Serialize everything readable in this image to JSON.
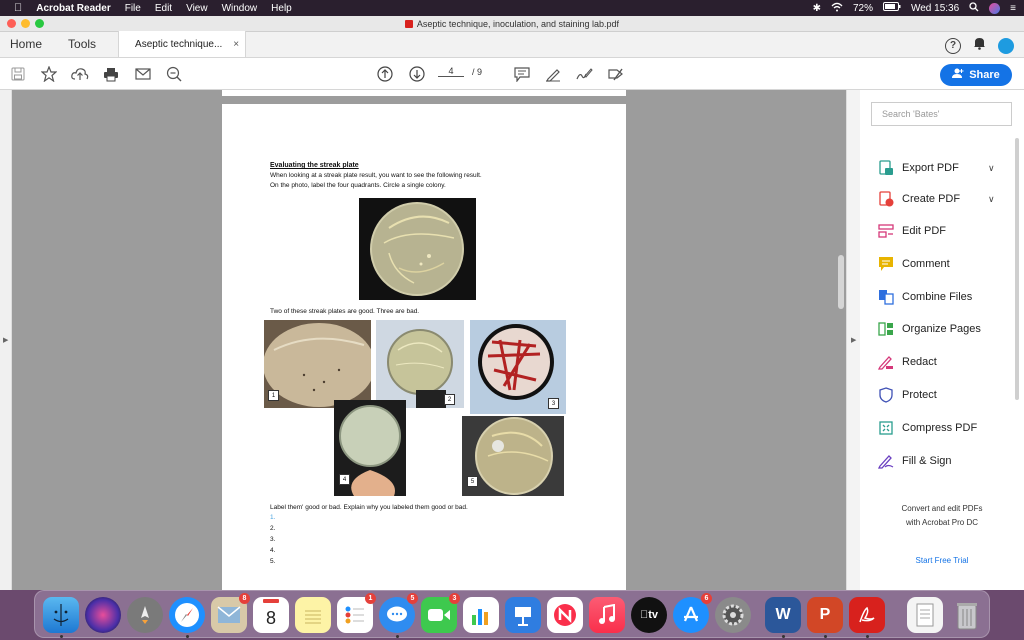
{
  "menubar": {
    "app_name": "Acrobat Reader",
    "menus": [
      "File",
      "Edit",
      "View",
      "Window",
      "Help"
    ],
    "battery": "72%",
    "datetime": "Wed 15:36"
  },
  "window": {
    "title": "Aseptic technique, inoculation, and staining lab.pdf"
  },
  "tabs": {
    "home": "Home",
    "tools": "Tools",
    "doc": "Aseptic technique...",
    "close": "×"
  },
  "toolbar": {
    "page_current": "4",
    "page_total": "/ 9",
    "share": "Share"
  },
  "document": {
    "heading": "Evaluating the streak plate",
    "line1": "When looking at a streak plate result, you want to see the following result.",
    "line2": "On the photo, label the four quadrants.  Circle a single colony.",
    "line3": "Two of these streak plates are good.  Three are bad.",
    "line4": "Label them' good or bad.  Explain why you labeled them good or bad.",
    "answers": [
      "1.",
      "2.",
      "3.",
      "4.",
      "5."
    ],
    "photo_numbers": [
      "1",
      "2",
      "3",
      "4",
      "5"
    ]
  },
  "right_panel": {
    "search_placeholder": "Search 'Bates'",
    "tools": [
      {
        "label": "Export PDF",
        "icon": "export-pdf-icon",
        "color": "#2a9d8f"
      },
      {
        "label": "Create PDF",
        "icon": "create-pdf-icon",
        "color": "#e5403a"
      },
      {
        "label": "Edit PDF",
        "icon": "edit-pdf-icon",
        "color": "#d5387a"
      },
      {
        "label": "Comment",
        "icon": "comment-icon",
        "color": "#e8b400"
      },
      {
        "label": "Combine Files",
        "icon": "combine-files-icon",
        "color": "#2f6fde"
      },
      {
        "label": "Organize Pages",
        "icon": "organize-pages-icon",
        "color": "#3aa64b"
      },
      {
        "label": "Redact",
        "icon": "redact-icon",
        "color": "#d5387a"
      },
      {
        "label": "Protect",
        "icon": "protect-icon",
        "color": "#3f51b5"
      },
      {
        "label": "Compress PDF",
        "icon": "compress-pdf-icon",
        "color": "#2a9d8f"
      },
      {
        "label": "Fill & Sign",
        "icon": "fill-sign-icon",
        "color": "#6a3fc0"
      }
    ],
    "promo_line1": "Convert and edit PDFs",
    "promo_line2": "with Acrobat Pro DC",
    "trial": "Start Free Trial"
  },
  "dock": {
    "calendar_day": "8",
    "badges": {
      "mail": "8",
      "reminders": "1",
      "messages": "5",
      "facetime": "3",
      "appstore": "6"
    }
  }
}
